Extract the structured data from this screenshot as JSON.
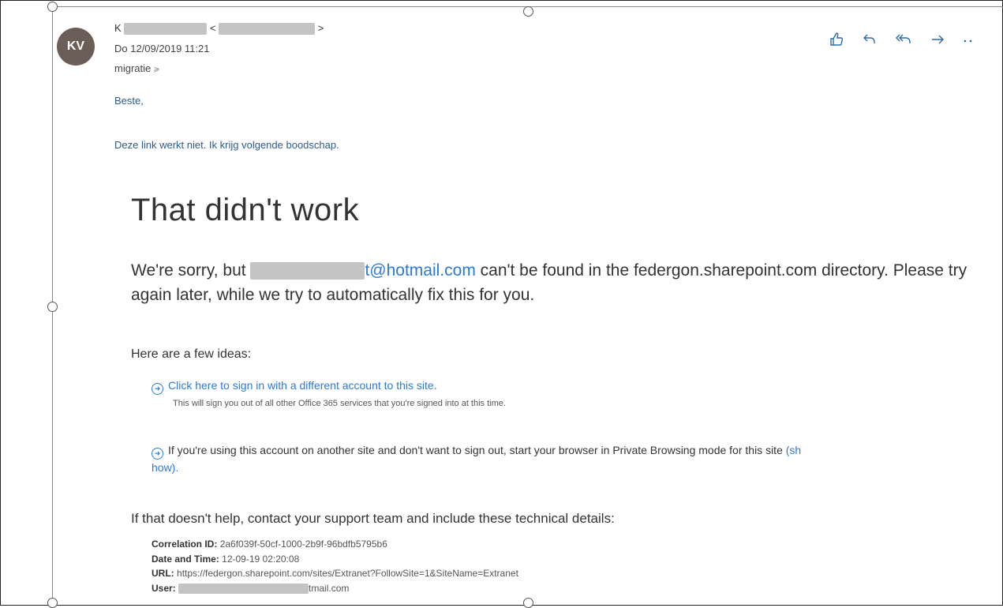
{
  "email": {
    "avatar_initials": "KV",
    "sender_prefix": "K",
    "sender_bracket_open": "<",
    "sender_bracket_close": ">",
    "date": "Do 12/09/2019 11:21",
    "subject": "migratie",
    "greeting": "Beste,",
    "message": "Deze link werkt niet. Ik krijg volgende boodschap.",
    "toolbar": [
      {
        "name": "like-icon",
        "glyph": "👍"
      },
      {
        "name": "reply-icon",
        "glyph": "↶"
      },
      {
        "name": "reply-all-icon",
        "glyph": "«"
      },
      {
        "name": "forward-icon",
        "glyph": "→"
      },
      {
        "name": "more-icon",
        "glyph": "··"
      }
    ]
  },
  "error_page": {
    "title": "That didn't work",
    "sorry_prefix": "We're sorry, but ",
    "email_suffix": "t@hotmail.com",
    "sorry_rest": " can't be found in the federgon.sharepoint.com directory. Please try again later, while we try to automatically fix this for you.",
    "ideas_heading": "Here are a few ideas:",
    "idea1_link": "Click here to sign in with a different account to this site.",
    "idea1_sub": "This will sign you out of all other Office 365 services that you're signed into at this time.",
    "idea2_text": "If you're using this account on another site and don't want to sign out, start your browser in Private Browsing mode for this site ",
    "idea2_link_a": "(sh",
    "idea2_link_b": "how).",
    "help_text": "If that doesn't help, contact your support team and include these technical details:",
    "details": {
      "correlation_label": "Correlation ID:",
      "correlation_value": "2a6f039f-50cf-1000-2b9f-96bdfb5795b6",
      "datetime_label": "Date and Time:",
      "datetime_value": "12-09-19 02:20:08",
      "url_label": "URL:",
      "url_value": "https://federgon.sharepoint.com/sites/Extranet?FollowSite=1&SiteName=Extranet",
      "user_label": "User:",
      "user_suffix": "tmail.com"
    }
  }
}
